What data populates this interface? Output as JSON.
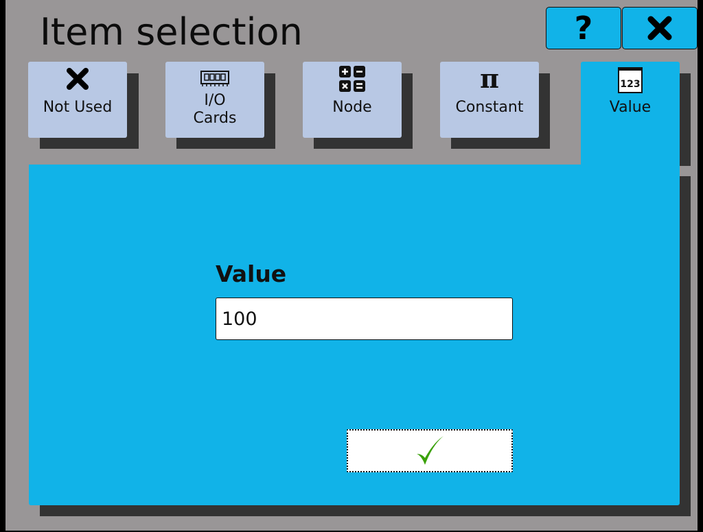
{
  "header": {
    "title": "Item selection",
    "help_label": "?",
    "close_icon": "close-icon",
    "help_icon": "question-mark-icon"
  },
  "tabs": [
    {
      "label": "Not Used",
      "icon": "x-icon",
      "active": false
    },
    {
      "label_line1": "I/O",
      "label_line2": "Cards",
      "icon": "io-card-icon",
      "active": false
    },
    {
      "label": "Node",
      "icon": "calculator-ops-icon",
      "active": false
    },
    {
      "label": "Constant",
      "icon_text": "π",
      "icon": "pi-icon",
      "active": false
    },
    {
      "label": "Value",
      "icon_text": "123",
      "icon": "number-123-icon",
      "active": true
    }
  ],
  "form": {
    "value_label": "Value",
    "value_input": "100",
    "confirm_icon": "checkmark-icon"
  },
  "colors": {
    "background": "#999697",
    "accent": "#11b3e8",
    "tab_inactive": "#b8c8e4",
    "shadow": "#333333",
    "check_green": "#3aa10a"
  }
}
